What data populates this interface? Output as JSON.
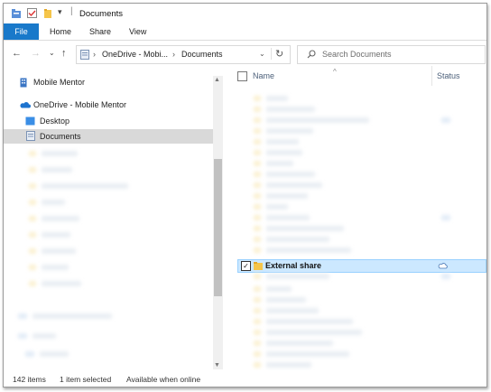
{
  "window": {
    "title": "Documents"
  },
  "ribbon": {
    "tabs": [
      "File",
      "Home",
      "Share",
      "View"
    ]
  },
  "address": {
    "crumbs": [
      "OneDrive - Mobi...",
      "Documents"
    ],
    "search_placeholder": "Search Documents"
  },
  "nav": {
    "mobile_mentor": "Mobile Mentor",
    "onedrive": "OneDrive - Mobile Mentor",
    "desktop": "Desktop",
    "documents": "Documents"
  },
  "columns": {
    "name": "Name",
    "status": "Status"
  },
  "files": {
    "selected_name": "External share"
  },
  "status": {
    "items": "142 items",
    "selected": "1 item selected",
    "availability": "Available when online"
  },
  "colors": {
    "accent": "#1979ca",
    "selection": "#cce8ff",
    "folder": "#f5c54a"
  }
}
